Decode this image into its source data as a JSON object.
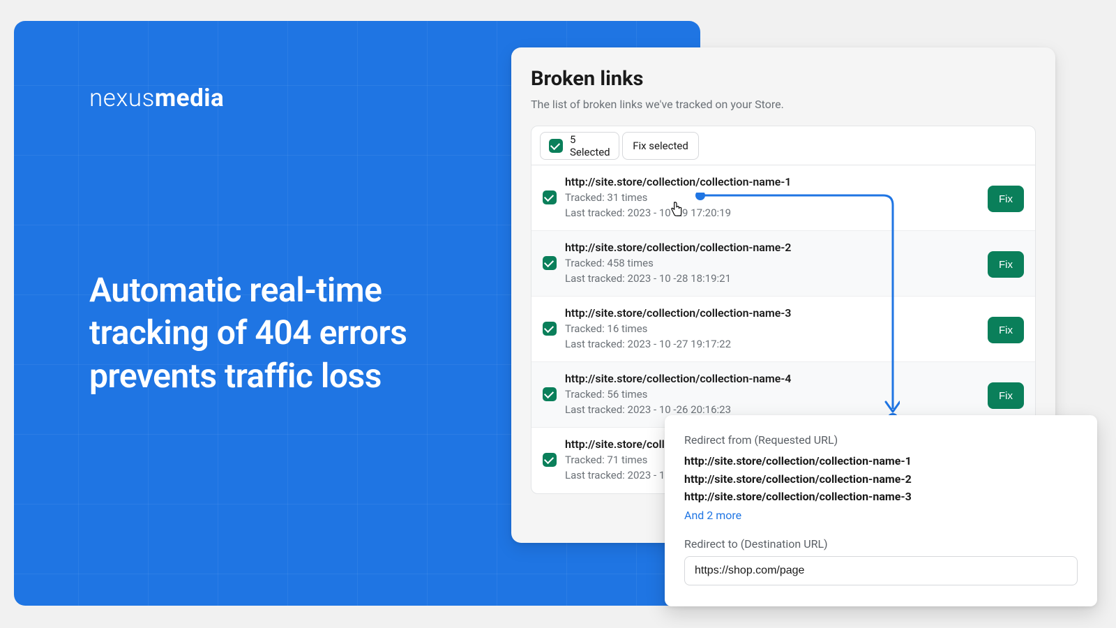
{
  "logo": {
    "thin": "nexus",
    "bold": "media"
  },
  "headline": "Automatic real-time tracking of 404 errors prevents traffic loss",
  "card": {
    "title": "Broken links",
    "subtitle": "The list of broken links we've tracked on your Store.",
    "selected_label": "5 Selected",
    "fix_selected_label": "Fix selected",
    "fix_button": "Fix",
    "rows": [
      {
        "url": "http://site.store/collection/collection-name-1",
        "tracked": "Tracked: 31 times",
        "last": "Last tracked: 2023 - 10 -29  17:20:19"
      },
      {
        "url": "http://site.store/collection/collection-name-2",
        "tracked": "Tracked: 458 times",
        "last": "Last tracked: 2023 - 10 -28  18:19:21"
      },
      {
        "url": "http://site.store/collection/collection-name-3",
        "tracked": "Tracked: 16 times",
        "last": "Last tracked: 2023 - 10 -27  19:17:22"
      },
      {
        "url": "http://site.store/collection/collection-name-4",
        "tracked": "Tracked: 56 times",
        "last": "Last tracked: 2023 - 10 -26  20:16:23"
      },
      {
        "url": "http://site.store/colle",
        "tracked": "Tracked: 71 times",
        "last": "Last tracked: 2023 - 1"
      }
    ]
  },
  "popover": {
    "from_label": "Redirect from (Requested URL)",
    "urls": [
      "http://site.store/collection/collection-name-1",
      "http://site.store/collection/collection-name-2",
      "http://site.store/collection/collection-name-3"
    ],
    "more": "And 2 more",
    "to_label": "Redirect to (Destination URL)",
    "to_value": "https://shop.com/page"
  }
}
